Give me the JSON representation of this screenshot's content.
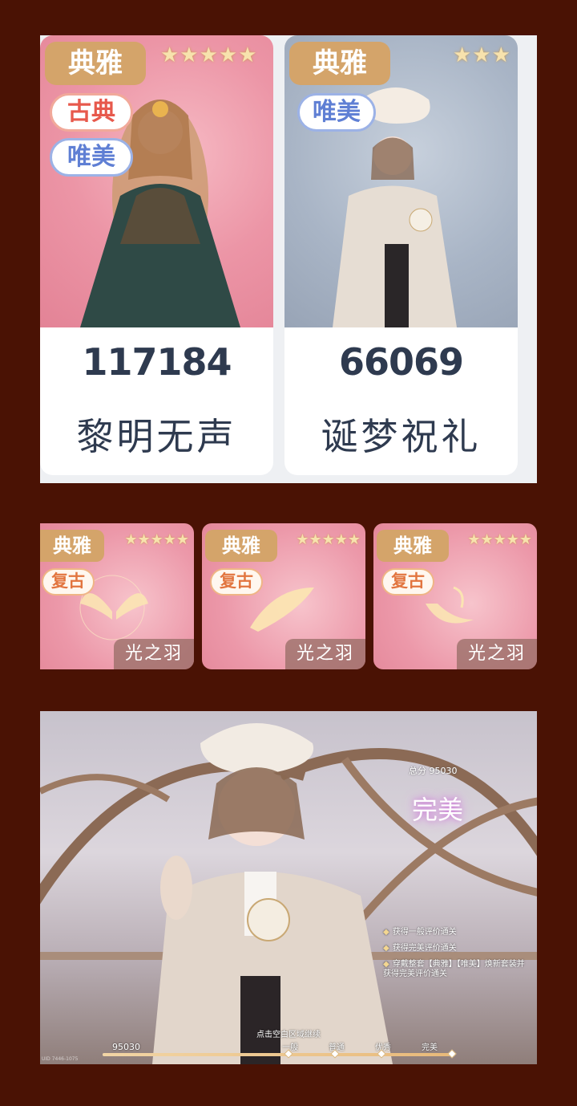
{
  "cards": [
    {
      "style_tag": "典雅",
      "stars": "★★★★★",
      "tags": [
        "古典",
        "唯美"
      ],
      "score": "117184",
      "name": "黎明无声"
    },
    {
      "style_tag": "典雅",
      "stars": "★★★",
      "tags": [
        "唯美"
      ],
      "score": "66069",
      "name": "诞梦祝礼"
    }
  ],
  "items": [
    {
      "style_tag": "典雅",
      "stars": "★★★★★",
      "tag": "复古",
      "name": "光之羽"
    },
    {
      "style_tag": "典雅",
      "stars": "★★★★★",
      "tag": "复古",
      "name": "光之羽"
    },
    {
      "style_tag": "典雅",
      "stars": "★★★★★",
      "tag": "复古",
      "name": "光之羽"
    }
  ],
  "result": {
    "total_label": "总分 95030",
    "rating": "完美",
    "requirements": [
      "获得一般评价通关",
      "获得完美评价通关",
      "穿戴整套【典雅】【唯美】焕新套装并获得完美评价通关"
    ],
    "continue_hint": "点击空白区域继续",
    "score": "95030",
    "levels": [
      "一般",
      "普通",
      "优秀",
      "完美"
    ],
    "progress": 1.0,
    "watermark": "UID 7446-1075"
  },
  "colors": {
    "background": "#4a1204",
    "tag_gold": "#d4a46a",
    "text_dark": "#2e3a4f",
    "classic_red": "#e7594c",
    "beauty_blue": "#5f7fd4",
    "retro_orange": "#e2753f"
  }
}
